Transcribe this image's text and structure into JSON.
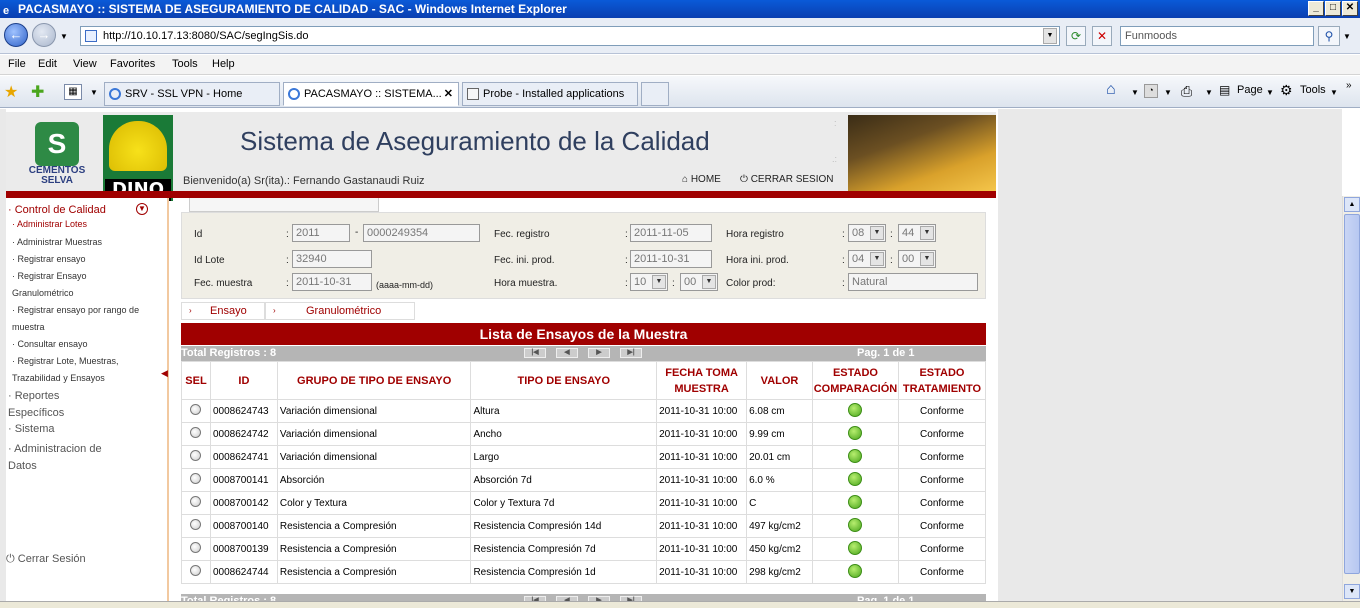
{
  "window": {
    "title": "PACASMAYO :: SISTEMA DE ASEGURAMIENTO DE CALIDAD - SAC - Windows Internet Explorer"
  },
  "browser": {
    "url": "http://10.10.17.13:8080/SAC/segIngSis.do",
    "search_placeholder": "Funmoods",
    "menu": [
      "File",
      "Edit",
      "View",
      "Favorites",
      "Tools",
      "Help"
    ],
    "tabs": [
      {
        "label": "SRV - SSL VPN - Home"
      },
      {
        "label": "PACASMAYO :: SISTEMA..."
      },
      {
        "label": "Probe - Installed applications"
      }
    ],
    "toolbar": {
      "page": "Page",
      "tools": "Tools"
    }
  },
  "header": {
    "logo_cs": "CEMENTOS SELVA",
    "logo_dino": "DINO",
    "title": "Sistema de Aseguramiento de la Calidad",
    "welcome": "Bienvenido(a) Sr(ita).: Fernando Gastanaudi Ruiz",
    "home": "HOME",
    "logout": "CERRAR SESION"
  },
  "sidebar": {
    "control": "Control de Calidad",
    "items": [
      "Administrar Lotes",
      "Administrar Muestras",
      "Registrar ensayo",
      "Registrar Ensayo Granulométrico",
      "Registrar ensayo por rango de muestra",
      "Consultar ensayo",
      "Registrar Lote, Muestras, Trazabilidad y Ensayos"
    ],
    "reportes": "Reportes Específicos",
    "sistema": "Sistema",
    "admin": "Administracion de Datos",
    "cerrar": "Cerrar Sesión"
  },
  "form": {
    "labels": {
      "id": "Id",
      "id_lote": "Id Lote",
      "fec_muestra": "Fec. muestra",
      "fec_registro": "Fec. registro",
      "fec_ini_prod": "Fec. ini. prod.",
      "hora_muestra": "Hora muestra.",
      "hora_registro": "Hora registro",
      "hora_ini_prod": "Hora ini. prod.",
      "color_prod": "Color prod:",
      "date_hint": "(aaaa-mm-dd)"
    },
    "values": {
      "id_year": "2011",
      "id_num": "0000249354",
      "id_lote": "32940",
      "fec_muestra": "2011-10-31",
      "fec_registro": "2011-11-05",
      "fec_ini_prod": "2011-10-31",
      "hora_muestra_h": "10",
      "hora_muestra_m": "00",
      "hora_registro_h": "08",
      "hora_registro_m": "44",
      "hora_ini_h": "04",
      "hora_ini_m": "00",
      "color_prod": "Natural"
    }
  },
  "subtabs": [
    "Ensayo",
    "Granulométrico"
  ],
  "list": {
    "title": "Lista de Ensayos de la Muestra",
    "total": "Total Registros : 8",
    "page": "Pag. 1 de 1",
    "columns": [
      "SEL",
      "ID",
      "GRUPO DE TIPO DE ENSAYO",
      "TIPO DE ENSAYO",
      "FECHA TOMA MUESTRA",
      "VALOR",
      "ESTADO COMPARACIÓN",
      "ESTADO TRATAMIENTO"
    ],
    "rows": [
      {
        "id": "0008624743",
        "grupo": "Variación dimensional",
        "tipo": "Altura",
        "fecha": "2011-10-31 10:00",
        "valor": "6.08 cm",
        "tratamiento": "Conforme"
      },
      {
        "id": "0008624742",
        "grupo": "Variación dimensional",
        "tipo": "Ancho",
        "fecha": "2011-10-31 10:00",
        "valor": "9.99 cm",
        "tratamiento": "Conforme"
      },
      {
        "id": "0008624741",
        "grupo": "Variación dimensional",
        "tipo": "Largo",
        "fecha": "2011-10-31 10:00",
        "valor": "20.01 cm",
        "tratamiento": "Conforme"
      },
      {
        "id": "0008700141",
        "grupo": "Absorción",
        "tipo": "Absorción 7d",
        "fecha": "2011-10-31 10:00",
        "valor": "6.0 %",
        "tratamiento": "Conforme"
      },
      {
        "id": "0008700142",
        "grupo": "Color y Textura",
        "tipo": "Color y Textura 7d",
        "fecha": "2011-10-31 10:00",
        "valor": "C",
        "tratamiento": "Conforme"
      },
      {
        "id": "0008700140",
        "grupo": "Resistencia a Compresión",
        "tipo": "Resistencia Compresión 14d",
        "fecha": "2011-10-31 10:00",
        "valor": "497 kg/cm2",
        "tratamiento": "Conforme"
      },
      {
        "id": "0008700139",
        "grupo": "Resistencia a Compresión",
        "tipo": "Resistencia Compresión 7d",
        "fecha": "2011-10-31 10:00",
        "valor": "450 kg/cm2",
        "tratamiento": "Conforme"
      },
      {
        "id": "0008624744",
        "grupo": "Resistencia a Compresión",
        "tipo": "Resistencia Compresión 1d",
        "fecha": "2011-10-31 10:00",
        "valor": "298 kg/cm2",
        "tratamiento": "Conforme"
      }
    ]
  }
}
